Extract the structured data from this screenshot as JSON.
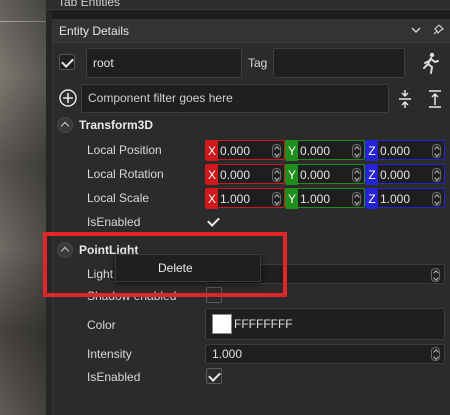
{
  "window": {
    "title": "Tab Entities"
  },
  "panel": {
    "title": "Entity Details"
  },
  "entity": {
    "enabled": true,
    "name": "root",
    "tag_label": "Tag",
    "tag_value": ""
  },
  "filter": {
    "placeholder": "Component filter goes here"
  },
  "transform": {
    "title": "Transform3D",
    "rows": [
      {
        "label": "Local Position",
        "x": "0.000",
        "y": "0.000",
        "z": "0.000"
      },
      {
        "label": "Local Rotation",
        "x": "0.000",
        "y": "0.000",
        "z": "0.000"
      },
      {
        "label": "Local Scale",
        "x": "1.000",
        "y": "1.000",
        "z": "1.000"
      }
    ],
    "isenabled_label": "IsEnabled",
    "isenabled": true,
    "axes": [
      "X",
      "Y",
      "Z"
    ]
  },
  "pointlight": {
    "title": "PointLight",
    "light_label": "Light",
    "shadow_label": "Shadow enabled",
    "shadow_enabled": false,
    "color_label": "Color",
    "color_value": "FFFFFFFF",
    "color_hex": "#FFFFFF",
    "intensity_label": "Intensity",
    "intensity_value": "1.000",
    "isenabled_label": "IsEnabled",
    "isenabled": true
  },
  "context_menu": {
    "delete_label": "Delete"
  },
  "colors": {
    "axis_x": "#d01a1a",
    "axis_y": "#1d8f1d",
    "axis_z": "#2424d6",
    "highlight": "#e0262b"
  }
}
